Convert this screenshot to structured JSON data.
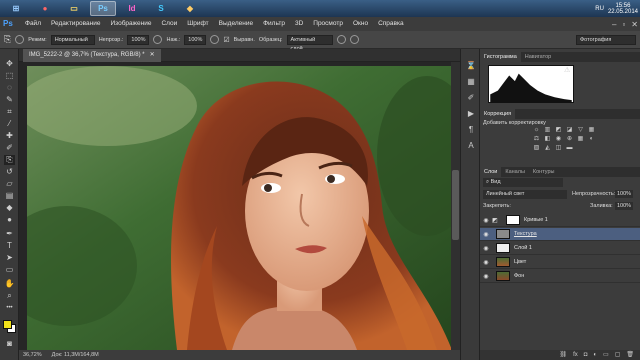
{
  "taskbar": {
    "buttons": [
      {
        "name": "start-button",
        "glyph": "⊞"
      },
      {
        "name": "chrome-button",
        "glyph": "●"
      },
      {
        "name": "explorer-button",
        "glyph": "▭"
      },
      {
        "name": "photoshop-button",
        "glyph": "Ps"
      },
      {
        "name": "indesign-button",
        "glyph": "Id"
      },
      {
        "name": "skype-button",
        "glyph": "S"
      },
      {
        "name": "tool-button",
        "glyph": "◆"
      }
    ],
    "lang": "RU",
    "time": "15:56",
    "date": "22.05.2014"
  },
  "app": {
    "logo": "Ps"
  },
  "menu": [
    "Файл",
    "Редактирование",
    "Изображение",
    "Слои",
    "Шрифт",
    "Выделение",
    "Фильтр",
    "3D",
    "Просмотр",
    "Окно",
    "Справка"
  ],
  "options": {
    "mode_label": "Режим:",
    "mode_value": "Нормальный",
    "opacity_label": "Непрозр.:",
    "opacity_value": "100%",
    "pressure_label": "Наж.:",
    "pressure_value": "100%",
    "align_label": "Выравн.",
    "sample_label": "Образец:",
    "sample_value": "Активный слой",
    "workspace_value": "Фотография"
  },
  "document": {
    "tab_label": "IMG_5222-2 @ 36,7% (Текстура, RGB/8) *",
    "zoom": "36,72%",
    "doc_info": "Док: 11,3M/164,8M"
  },
  "panels": {
    "top_tabs": [
      "Гистограмма",
      "Навигатор"
    ],
    "corrections_tab": "Коррекция",
    "corrections_title": "Добавить корректировку",
    "layers_tabs": [
      "Слои",
      "Каналы",
      "Контуры"
    ],
    "filter_label": "Вид",
    "blend_mode": "Линейный свет",
    "opacity_label": "Непрозрачность:",
    "opacity_value": "100%",
    "lock_label": "Закрепить:",
    "fill_label": "Заливка:",
    "fill_value": "100%",
    "layers": [
      {
        "name": "Кривые 1",
        "selected": false
      },
      {
        "name": "Текстура",
        "selected": true
      },
      {
        "name": "Слой 1",
        "selected": false
      },
      {
        "name": "Цвет",
        "selected": false
      },
      {
        "name": "Фон",
        "selected": false
      }
    ]
  },
  "colors": {
    "foreground": "#f2e21a",
    "background": "#ffffff",
    "accent": "#4c5f80"
  }
}
